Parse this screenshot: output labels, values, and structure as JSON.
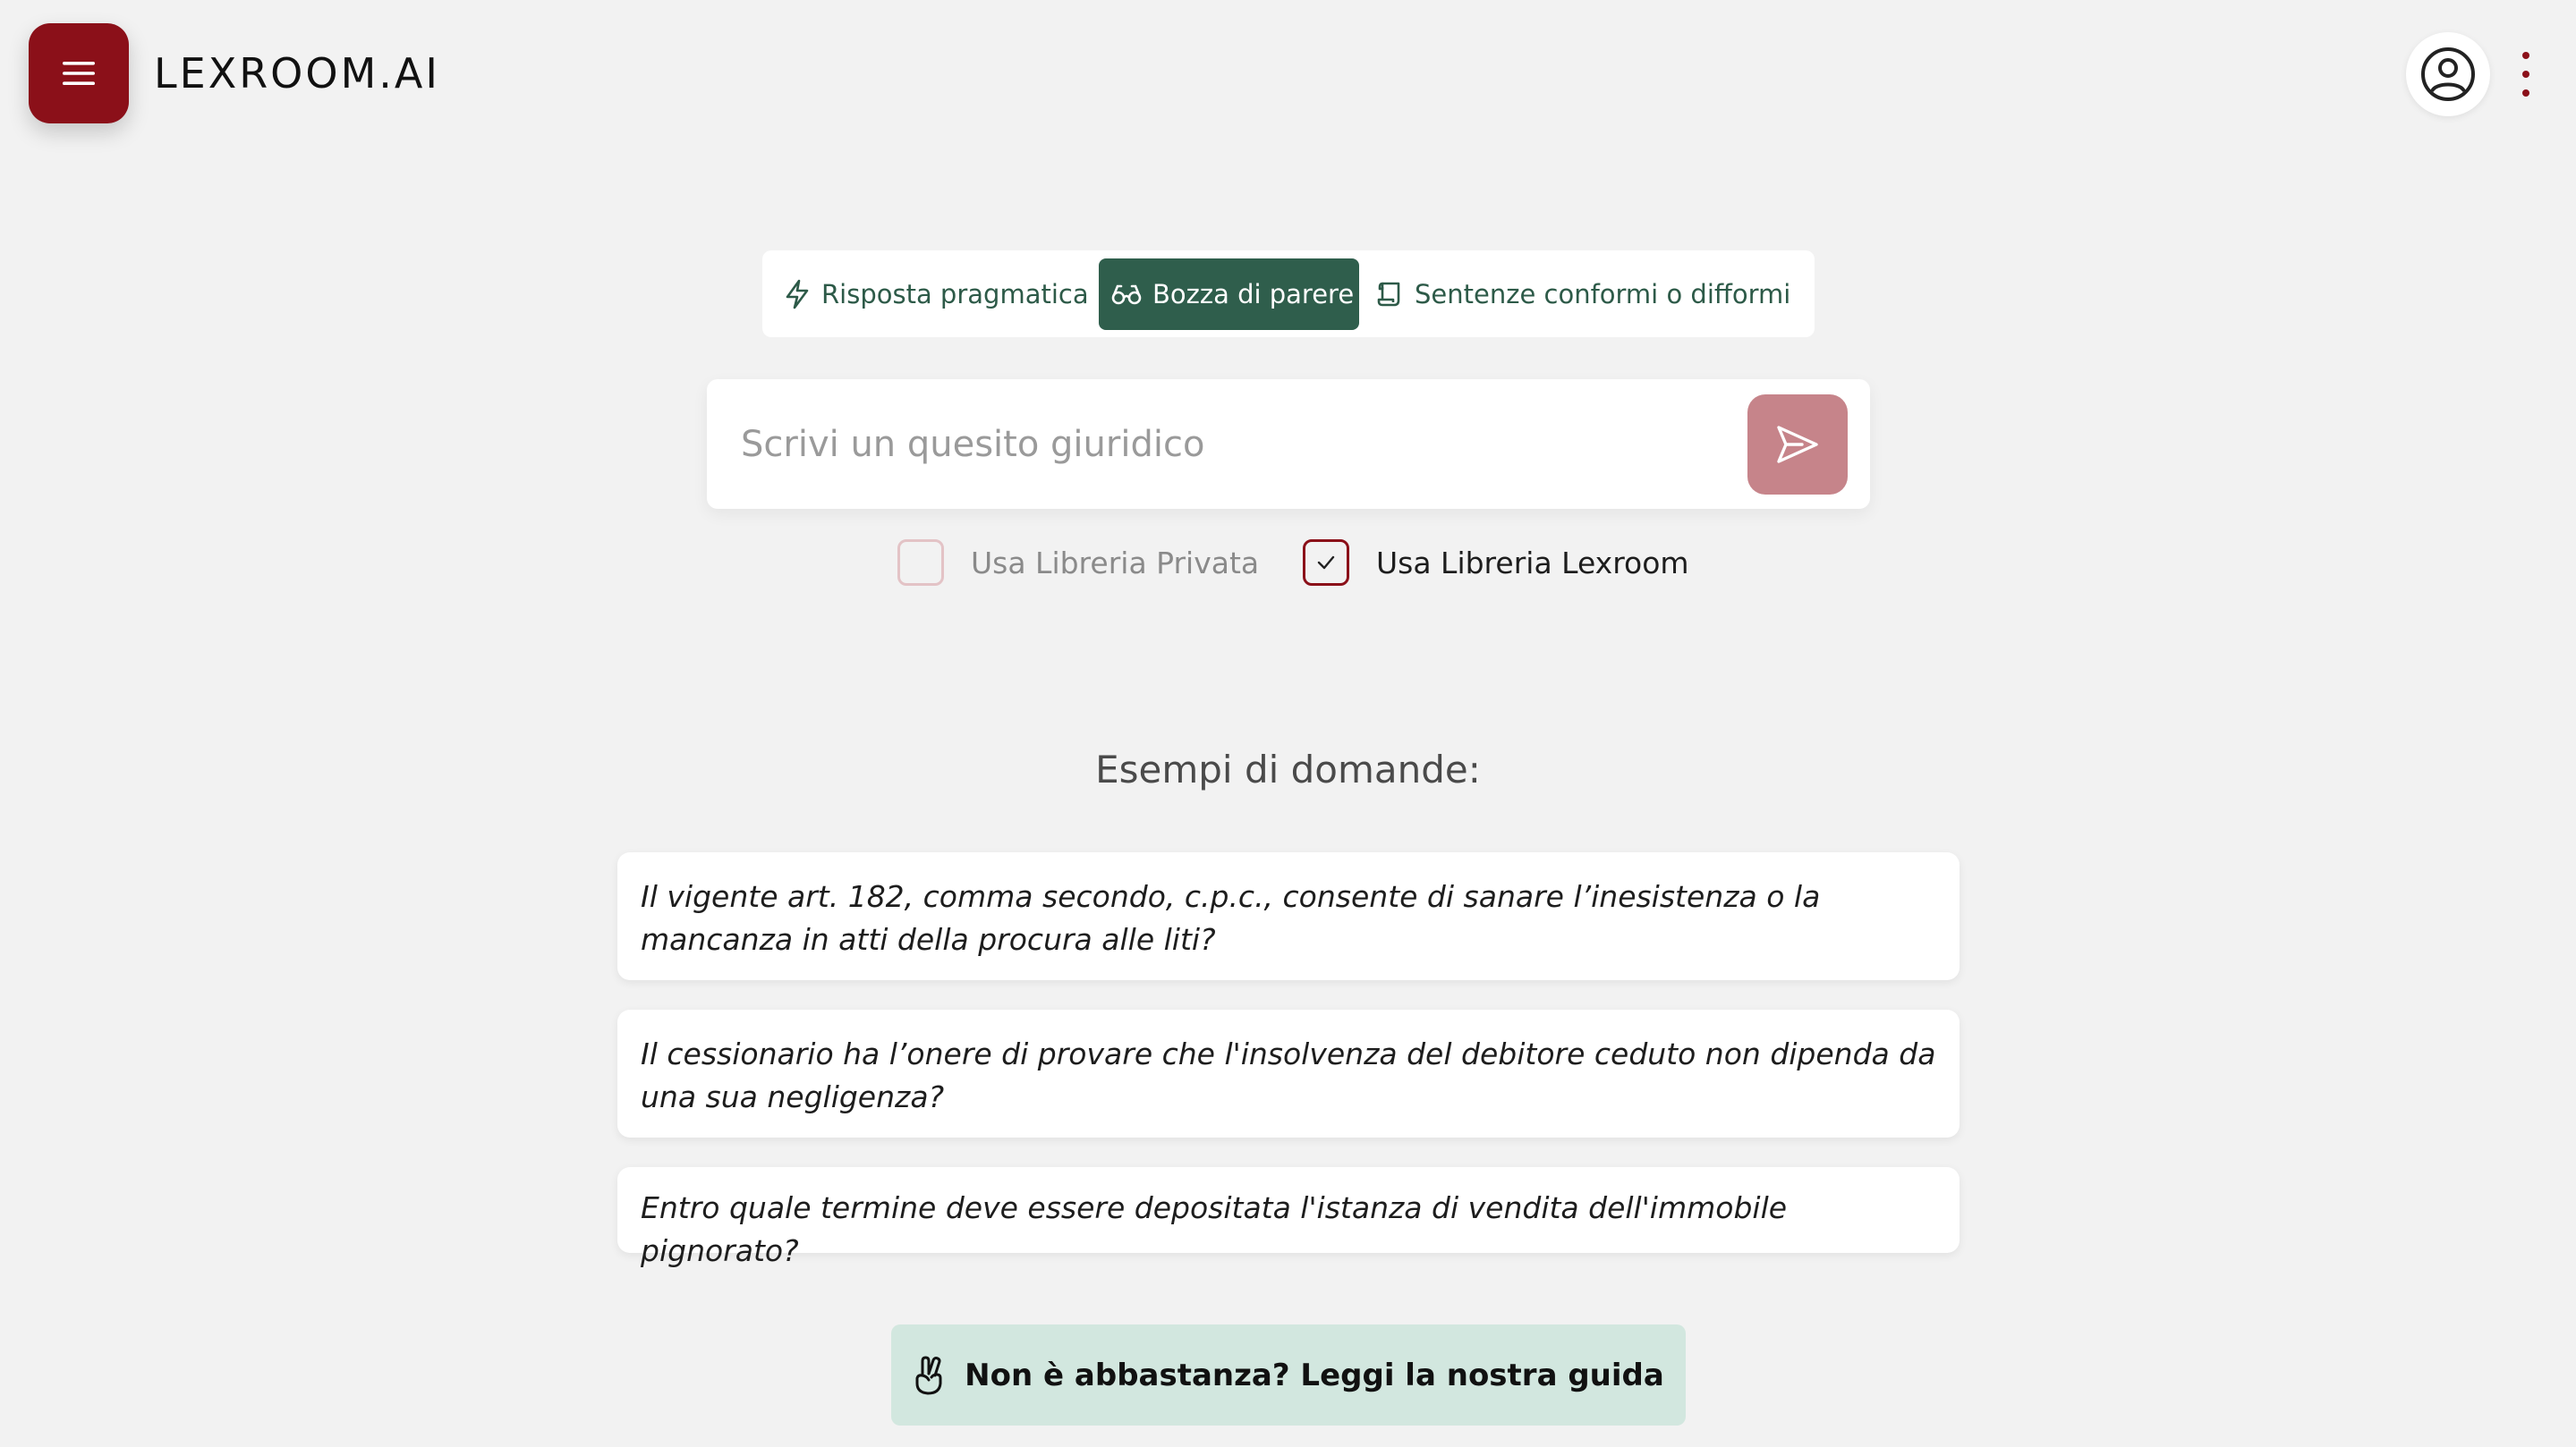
{
  "header": {
    "logo_text": "LEXROOM.AI",
    "menu_icon": "hamburger-icon",
    "user_icon": "user-circle-icon",
    "more_icon": "kebab-vertical-icon",
    "brand_color": "#8b1019"
  },
  "mode_tabs": [
    {
      "label": "Risposta pragmatica",
      "icon": "lightning-icon",
      "active": false
    },
    {
      "label": "Bozza di parere",
      "icon": "glasses-icon",
      "active": true
    },
    {
      "label": "Sentenze conformi o difformi",
      "icon": "scroll-icon",
      "active": false
    }
  ],
  "query": {
    "placeholder": "Scrivi un quesito giuridico",
    "value": "",
    "send_icon": "send-icon"
  },
  "options": {
    "private_library": {
      "label": "Usa Libreria Privata",
      "checked": false
    },
    "lexroom_library": {
      "label": "Usa Libreria Lexroom",
      "checked": true
    }
  },
  "examples": {
    "title": "Esempi di domande:",
    "items": [
      "Il vigente art. 182, comma secondo, c.p.c., consente di sanare l’inesistenza o la mancanza in atti della procura alle liti?",
      "Il cessionario ha l’onere di provare che l'insolvenza del debitore ceduto non dipenda da una sua negligenza?",
      "Entro quale termine deve essere depositata l'istanza di vendita dell'immobile pignorato?"
    ]
  },
  "guide": {
    "label": "Non è abbastanza? Leggi la nostra guida",
    "icon": "victory-hand-icon",
    "color": "#d2e7df"
  }
}
